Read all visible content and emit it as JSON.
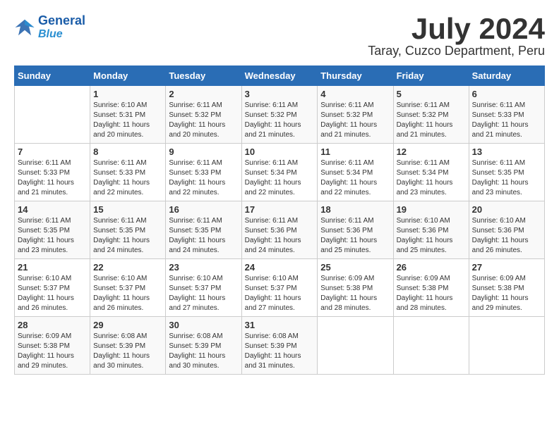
{
  "header": {
    "logo_line1": "General",
    "logo_line2": "Blue",
    "month": "July 2024",
    "location": "Taray, Cuzco Department, Peru"
  },
  "weekdays": [
    "Sunday",
    "Monday",
    "Tuesday",
    "Wednesday",
    "Thursday",
    "Friday",
    "Saturday"
  ],
  "weeks": [
    [
      {
        "day": "",
        "info": ""
      },
      {
        "day": "1",
        "info": "Sunrise: 6:10 AM\nSunset: 5:31 PM\nDaylight: 11 hours\nand 20 minutes."
      },
      {
        "day": "2",
        "info": "Sunrise: 6:11 AM\nSunset: 5:32 PM\nDaylight: 11 hours\nand 20 minutes."
      },
      {
        "day": "3",
        "info": "Sunrise: 6:11 AM\nSunset: 5:32 PM\nDaylight: 11 hours\nand 21 minutes."
      },
      {
        "day": "4",
        "info": "Sunrise: 6:11 AM\nSunset: 5:32 PM\nDaylight: 11 hours\nand 21 minutes."
      },
      {
        "day": "5",
        "info": "Sunrise: 6:11 AM\nSunset: 5:32 PM\nDaylight: 11 hours\nand 21 minutes."
      },
      {
        "day": "6",
        "info": "Sunrise: 6:11 AM\nSunset: 5:33 PM\nDaylight: 11 hours\nand 21 minutes."
      }
    ],
    [
      {
        "day": "7",
        "info": "Sunrise: 6:11 AM\nSunset: 5:33 PM\nDaylight: 11 hours\nand 21 minutes."
      },
      {
        "day": "8",
        "info": "Sunrise: 6:11 AM\nSunset: 5:33 PM\nDaylight: 11 hours\nand 22 minutes."
      },
      {
        "day": "9",
        "info": "Sunrise: 6:11 AM\nSunset: 5:33 PM\nDaylight: 11 hours\nand 22 minutes."
      },
      {
        "day": "10",
        "info": "Sunrise: 6:11 AM\nSunset: 5:34 PM\nDaylight: 11 hours\nand 22 minutes."
      },
      {
        "day": "11",
        "info": "Sunrise: 6:11 AM\nSunset: 5:34 PM\nDaylight: 11 hours\nand 22 minutes."
      },
      {
        "day": "12",
        "info": "Sunrise: 6:11 AM\nSunset: 5:34 PM\nDaylight: 11 hours\nand 23 minutes."
      },
      {
        "day": "13",
        "info": "Sunrise: 6:11 AM\nSunset: 5:35 PM\nDaylight: 11 hours\nand 23 minutes."
      }
    ],
    [
      {
        "day": "14",
        "info": "Sunrise: 6:11 AM\nSunset: 5:35 PM\nDaylight: 11 hours\nand 23 minutes."
      },
      {
        "day": "15",
        "info": "Sunrise: 6:11 AM\nSunset: 5:35 PM\nDaylight: 11 hours\nand 24 minutes."
      },
      {
        "day": "16",
        "info": "Sunrise: 6:11 AM\nSunset: 5:35 PM\nDaylight: 11 hours\nand 24 minutes."
      },
      {
        "day": "17",
        "info": "Sunrise: 6:11 AM\nSunset: 5:36 PM\nDaylight: 11 hours\nand 24 minutes."
      },
      {
        "day": "18",
        "info": "Sunrise: 6:11 AM\nSunset: 5:36 PM\nDaylight: 11 hours\nand 25 minutes."
      },
      {
        "day": "19",
        "info": "Sunrise: 6:10 AM\nSunset: 5:36 PM\nDaylight: 11 hours\nand 25 minutes."
      },
      {
        "day": "20",
        "info": "Sunrise: 6:10 AM\nSunset: 5:36 PM\nDaylight: 11 hours\nand 26 minutes."
      }
    ],
    [
      {
        "day": "21",
        "info": "Sunrise: 6:10 AM\nSunset: 5:37 PM\nDaylight: 11 hours\nand 26 minutes."
      },
      {
        "day": "22",
        "info": "Sunrise: 6:10 AM\nSunset: 5:37 PM\nDaylight: 11 hours\nand 26 minutes."
      },
      {
        "day": "23",
        "info": "Sunrise: 6:10 AM\nSunset: 5:37 PM\nDaylight: 11 hours\nand 27 minutes."
      },
      {
        "day": "24",
        "info": "Sunrise: 6:10 AM\nSunset: 5:37 PM\nDaylight: 11 hours\nand 27 minutes."
      },
      {
        "day": "25",
        "info": "Sunrise: 6:09 AM\nSunset: 5:38 PM\nDaylight: 11 hours\nand 28 minutes."
      },
      {
        "day": "26",
        "info": "Sunrise: 6:09 AM\nSunset: 5:38 PM\nDaylight: 11 hours\nand 28 minutes."
      },
      {
        "day": "27",
        "info": "Sunrise: 6:09 AM\nSunset: 5:38 PM\nDaylight: 11 hours\nand 29 minutes."
      }
    ],
    [
      {
        "day": "28",
        "info": "Sunrise: 6:09 AM\nSunset: 5:38 PM\nDaylight: 11 hours\nand 29 minutes."
      },
      {
        "day": "29",
        "info": "Sunrise: 6:08 AM\nSunset: 5:39 PM\nDaylight: 11 hours\nand 30 minutes."
      },
      {
        "day": "30",
        "info": "Sunrise: 6:08 AM\nSunset: 5:39 PM\nDaylight: 11 hours\nand 30 minutes."
      },
      {
        "day": "31",
        "info": "Sunrise: 6:08 AM\nSunset: 5:39 PM\nDaylight: 11 hours\nand 31 minutes."
      },
      {
        "day": "",
        "info": ""
      },
      {
        "day": "",
        "info": ""
      },
      {
        "day": "",
        "info": ""
      }
    ]
  ]
}
